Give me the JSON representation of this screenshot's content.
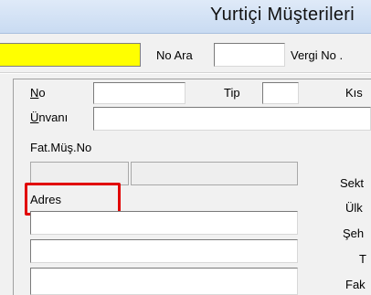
{
  "window": {
    "title": "Yurtiçi Müşterileri"
  },
  "toolbar": {
    "no_ara_label": "No Ara",
    "no_ara_value": "",
    "vergi_no_label": "Vergi No ."
  },
  "form": {
    "no_label_first": "N",
    "no_label_rest": "o",
    "no_value": "",
    "tip_label": "Tip",
    "tip_value": "",
    "kisa_label": "Kıs",
    "unvan_label_first": "Ü",
    "unvan_label_rest": "nvanı",
    "unvan_value": "",
    "fat_mus_no_label": "Fat.Müş.No",
    "fat_mus_no_value": "",
    "fat_mus_name_value": "",
    "sektor_label": "Sekt",
    "adres_label": "Adres",
    "adres_lines": [
      "",
      "",
      ""
    ],
    "ulke_label": "Ülk",
    "sehir_label": "Şeh",
    "t_label": "T",
    "fak_label": "Fak"
  },
  "colors": {
    "required_field": "#ffff00",
    "highlight": "#e10000"
  }
}
